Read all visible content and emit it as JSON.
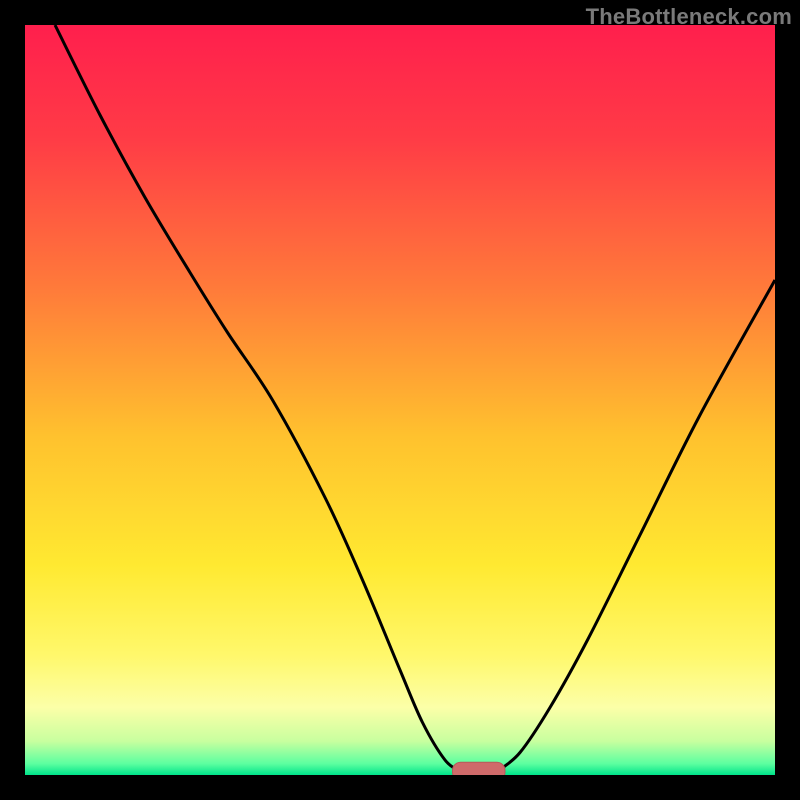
{
  "watermark": "TheBottleneck.com",
  "colors": {
    "frame": "#000000",
    "gradient_stops": [
      {
        "offset": 0.0,
        "color": "#ff1f4d"
      },
      {
        "offset": 0.15,
        "color": "#ff3b46"
      },
      {
        "offset": 0.35,
        "color": "#ff7a3a"
      },
      {
        "offset": 0.55,
        "color": "#ffc22e"
      },
      {
        "offset": 0.72,
        "color": "#ffe931"
      },
      {
        "offset": 0.84,
        "color": "#fff86b"
      },
      {
        "offset": 0.91,
        "color": "#fcffa8"
      },
      {
        "offset": 0.955,
        "color": "#c8ff9f"
      },
      {
        "offset": 0.985,
        "color": "#5cffa0"
      },
      {
        "offset": 1.0,
        "color": "#00e38a"
      }
    ],
    "curve": "#000000",
    "marker_fill": "#cf6a6a",
    "marker_stroke": "#b55a5a"
  },
  "chart_data": {
    "type": "line",
    "title": "",
    "xlabel": "",
    "ylabel": "",
    "xlim": [
      0,
      100
    ],
    "ylim": [
      0,
      100
    ],
    "series": [
      {
        "name": "bottleneck-curve-left",
        "x": [
          4,
          10,
          16,
          22,
          27,
          33,
          40,
          45,
          50,
          53,
          56,
          58
        ],
        "y": [
          100,
          88,
          77,
          67,
          59,
          50,
          37,
          26,
          14,
          7,
          2,
          0.5
        ]
      },
      {
        "name": "bottleneck-curve-right",
        "x": [
          63,
          66,
          70,
          75,
          82,
          90,
          100
        ],
        "y": [
          0.5,
          3,
          9,
          18,
          32,
          48,
          66
        ]
      }
    ],
    "marker": {
      "x_center": 60.5,
      "y": 0.5,
      "width": 7,
      "height": 2.4
    }
  }
}
